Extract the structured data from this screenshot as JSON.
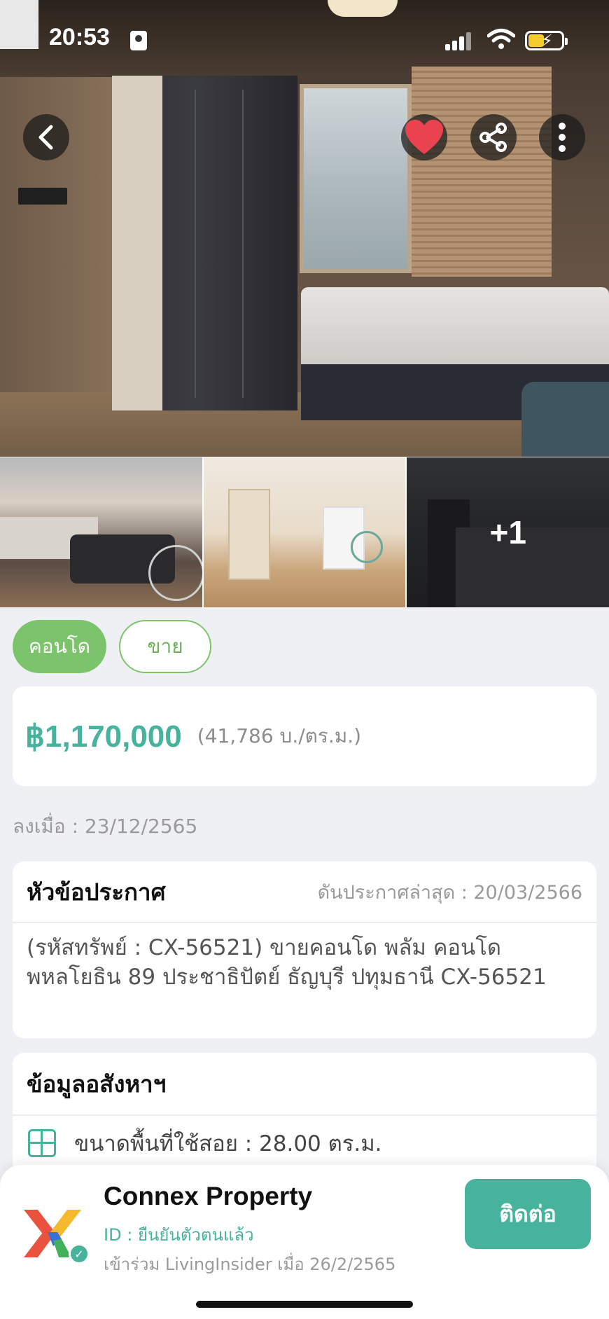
{
  "status_bar": {
    "time": "20:53"
  },
  "gallery": {
    "more_count": "+1"
  },
  "tags": {
    "type": "คอนโด",
    "listing": "ขาย"
  },
  "price": {
    "amount": "฿1,170,000",
    "per_sqm": "(41,786 บ./ตร.ม.)"
  },
  "posted": "ลงเมื่อ : 23/12/2565",
  "title_section": {
    "heading": "หัวข้อประกาศ",
    "boosted": "ดันประกาศล่าสุด : 20/03/2566",
    "text": "(รหัสทรัพย์ : CX-56521) ขายคอนโด  พลัม คอนโด พหลโยธิน 89 ประชาธิปัตย์ ธัญบุรี ปทุมธานี CX-56521"
  },
  "details_section": {
    "heading": "ข้อมูลอสังหาฯ",
    "area": "ขนาดพื้นที่ใช้สอย : 28.00 ตร.ม."
  },
  "agent": {
    "name": "Connex Property",
    "id_status": "ID : ยืนยันตัวตนแล้ว",
    "joined": "เข้าร่วม LivingInsider เมื่อ 26/2/2565",
    "contact_label": "ติดต่อ"
  },
  "colors": {
    "accent": "#47b39c",
    "tag_green": "#7cc46b",
    "heart": "#e8434f"
  },
  "icons": [
    "back-icon",
    "heart-icon",
    "share-icon",
    "more-icon",
    "area-icon",
    "verified-icon"
  ]
}
